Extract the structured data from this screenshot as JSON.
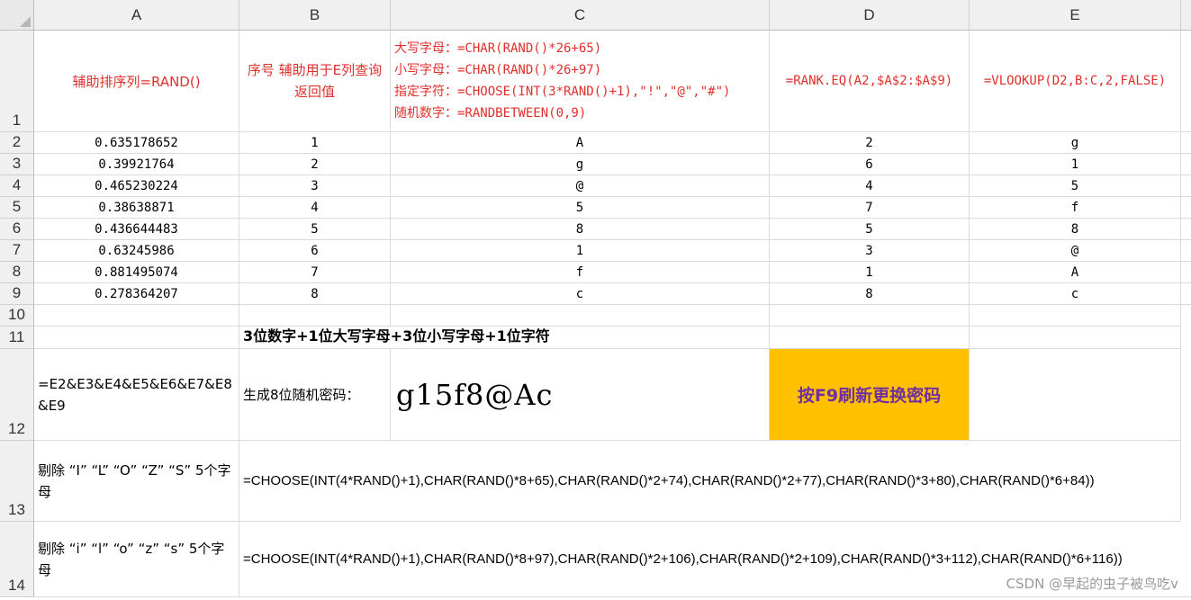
{
  "columns": [
    "A",
    "B",
    "C",
    "D",
    "E"
  ],
  "rows": [
    "1",
    "2",
    "3",
    "4",
    "5",
    "6",
    "7",
    "8",
    "9",
    "10",
    "11",
    "12",
    "13",
    "14"
  ],
  "header_row": {
    "a": "辅助排序列=RAND()",
    "b": "序号 辅助用于E列查询返回值",
    "c_lines": [
      "大写字母：=CHAR(RAND()*26+65)",
      "小写字母：=CHAR(RAND()*26+97)",
      "指定字符：=CHOOSE(INT(3*RAND()+1),\"!\",\"@\",\"#\")",
      "随机数字：=RANDBETWEEN(0,9)"
    ],
    "d": "=RANK.EQ(A2,$A$2:$A$9)",
    "e": "=VLOOKUP(D2,B:C,2,FALSE)"
  },
  "data_rows": [
    {
      "a": "0.635178652",
      "b": "1",
      "c": "A",
      "d": "2",
      "e": "g"
    },
    {
      "a": "0.39921764",
      "b": "2",
      "c": "g",
      "d": "6",
      "e": "1"
    },
    {
      "a": "0.465230224",
      "b": "3",
      "c": "@",
      "d": "4",
      "e": "5"
    },
    {
      "a": "0.38638871",
      "b": "4",
      "c": "5",
      "d": "7",
      "e": "f"
    },
    {
      "a": "0.436644483",
      "b": "5",
      "c": "8",
      "d": "5",
      "e": "8"
    },
    {
      "a": "0.63245986",
      "b": "6",
      "c": "1",
      "d": "3",
      "e": "@"
    },
    {
      "a": "0.881495074",
      "b": "7",
      "c": "f",
      "d": "1",
      "e": "A"
    },
    {
      "a": "0.278364207",
      "b": "8",
      "c": "c",
      "d": "8",
      "e": "c"
    }
  ],
  "row11": {
    "b": "3位数字+1位大写字母+3位小写字母+1位字符"
  },
  "row12": {
    "a": "=E2&E3&E4&E5&E6&E7&E8&E9",
    "b": "生成8位随机密码：",
    "c": "g15f8@Ac",
    "d": "按F9刷新更换密码"
  },
  "row13": {
    "a": "剔除 “I” “L” “O” “Z” “S” 5个字母",
    "b": "=CHOOSE(INT(4*RAND()+1),CHAR(RAND()*8+65),CHAR(RAND()*2+74),CHAR(RAND()*2+77),CHAR(RAND()*3+80),CHAR(RAND()*6+84))"
  },
  "row14": {
    "a": "剔除 “i” “l” “o” “z” “s” 5个字母",
    "b": "=CHOOSE(INT(4*RAND()+1),CHAR(RAND()*8+97),CHAR(RAND()*2+106),CHAR(RAND()*2+109),CHAR(RAND()*3+112),CHAR(RAND()*6+116))"
  },
  "watermark": "CSDN @早起的虫子被鸟吃v",
  "colors": {
    "accent_red": "#e0302b",
    "button_bg": "#ffc000",
    "button_text": "#7030a0"
  }
}
